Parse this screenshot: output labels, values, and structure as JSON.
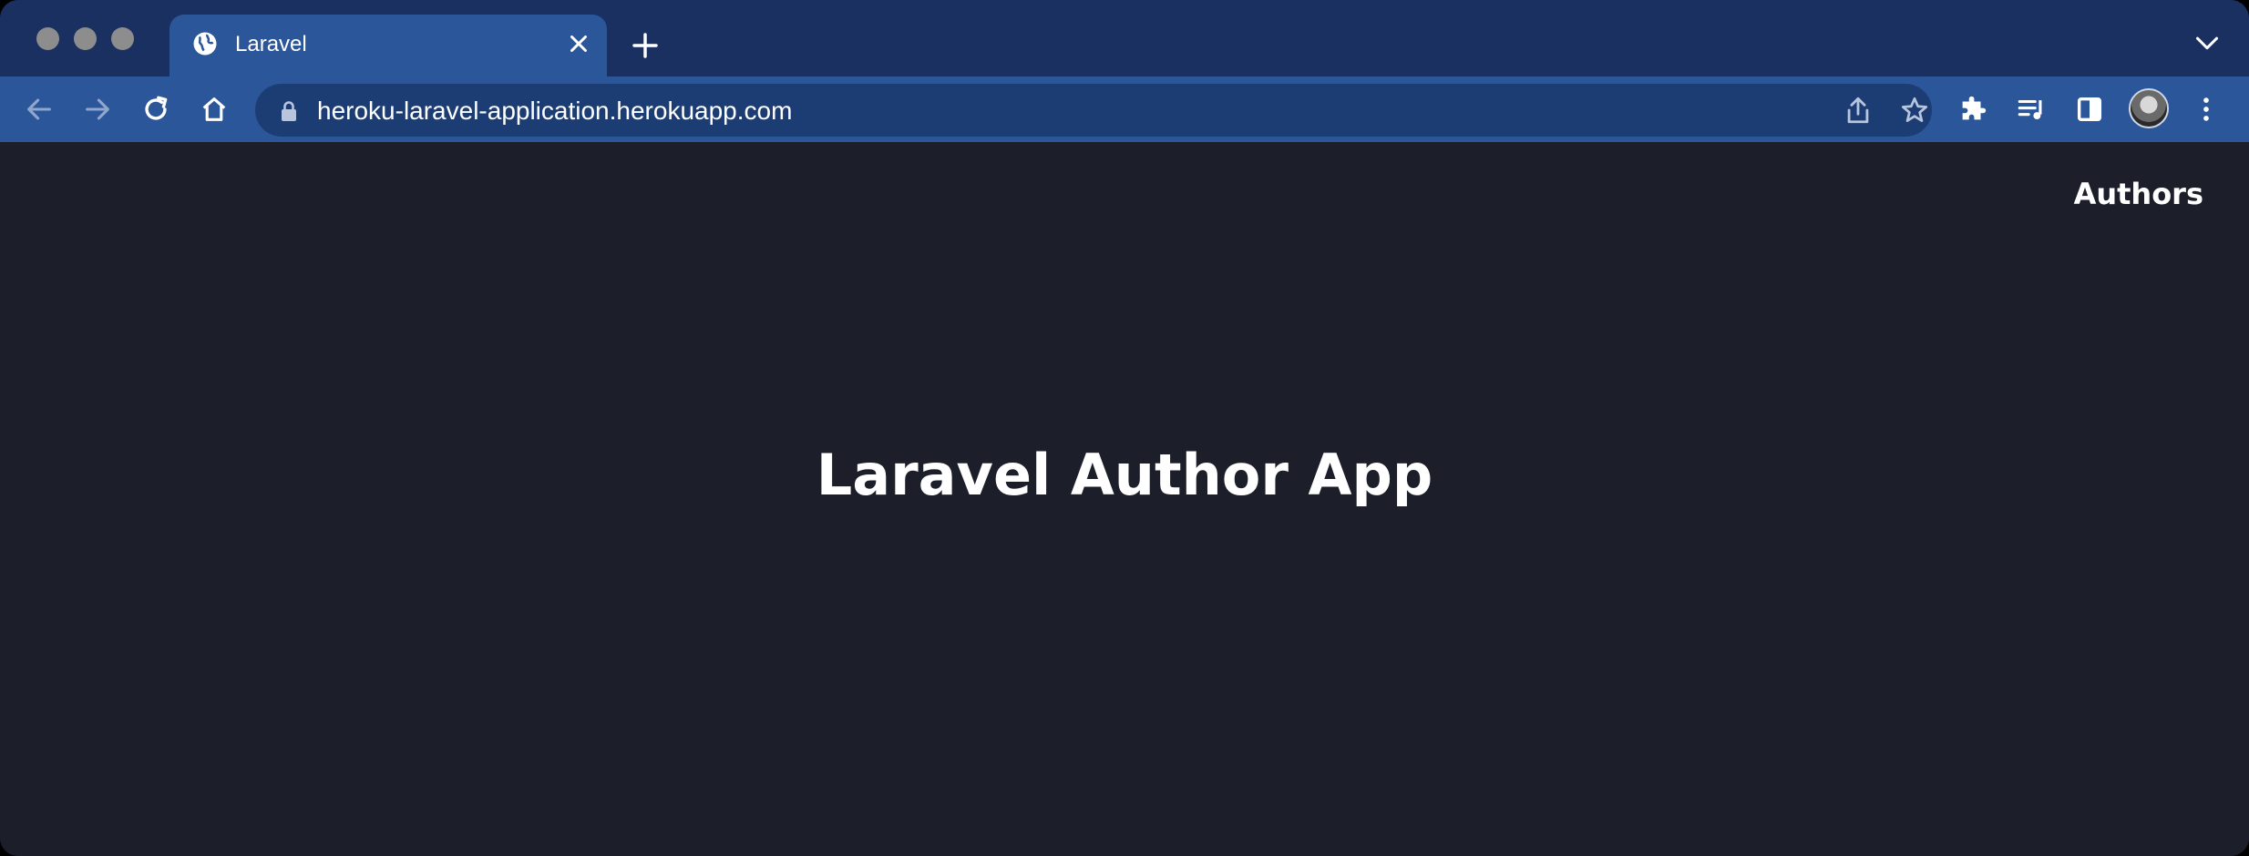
{
  "browser": {
    "tab": {
      "title": "Laravel",
      "icon": "globe-icon"
    },
    "new_tab_icon": "plus-icon",
    "tab_search_icon": "chevron-down-icon",
    "toolbar": {
      "back_icon": "arrow-left-icon",
      "forward_icon": "arrow-right-icon",
      "reload_icon": "reload-icon",
      "home_icon": "home-icon",
      "extensions_icon": "puzzle-icon",
      "media_icon": "media-queue-icon",
      "sidepanel_icon": "side-panel-icon",
      "menu_icon": "kebab-menu-icon"
    },
    "address_bar": {
      "url": "heroku-laravel-application.herokuapp.com",
      "share_icon": "share-icon",
      "bookmark_icon": "star-icon"
    }
  },
  "page": {
    "nav": {
      "authors_label": "Authors"
    },
    "hero": {
      "title": "Laravel Author App"
    }
  },
  "colors": {
    "tab_strip": "#1a3060",
    "toolbar": "#2b5699",
    "omnibox": "#1c3d73",
    "page_background": "#1c1f2a",
    "text": "#ffffff"
  }
}
